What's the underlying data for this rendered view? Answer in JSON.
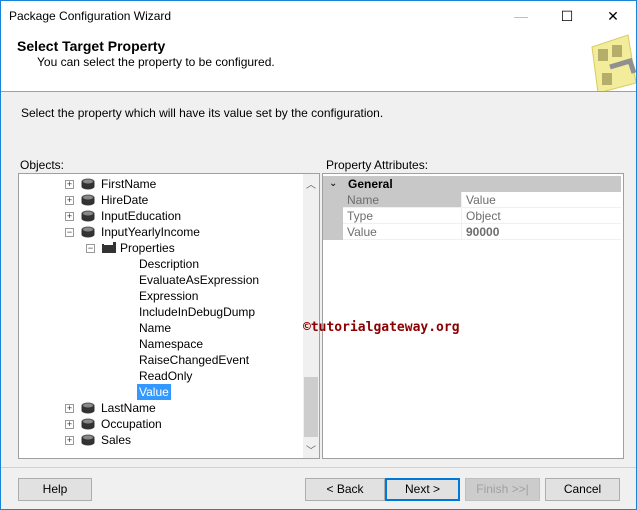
{
  "window": {
    "title": "Package Configuration Wizard",
    "minimize": "—",
    "maximize": "☐",
    "close": "✕"
  },
  "header": {
    "title": "Select Target Property",
    "subtitle": "You can select the property to be configured."
  },
  "instruction": "Select the property which will have its value set by the configuration.",
  "objects": {
    "label": "Objects:",
    "tree": [
      {
        "label": "FirstName",
        "level": 0,
        "expand": "+"
      },
      {
        "label": "HireDate",
        "level": 0,
        "expand": "+"
      },
      {
        "label": "InputEducation",
        "level": 0,
        "expand": "+"
      },
      {
        "label": "InputYearlyIncome",
        "level": 0,
        "expand": "−"
      },
      {
        "label": "Properties",
        "level": 1,
        "expand": "−"
      },
      {
        "label": "Description",
        "level": 2
      },
      {
        "label": "EvaluateAsExpression",
        "level": 2
      },
      {
        "label": "Expression",
        "level": 2
      },
      {
        "label": "IncludeInDebugDump",
        "level": 2
      },
      {
        "label": "Name",
        "level": 2
      },
      {
        "label": "Namespace",
        "level": 2
      },
      {
        "label": "RaiseChangedEvent",
        "level": 2
      },
      {
        "label": "ReadOnly",
        "level": 2
      },
      {
        "label": "Value",
        "level": 2,
        "selected": true
      },
      {
        "label": "LastName",
        "level": 0,
        "expand": "+"
      },
      {
        "label": "Occupation",
        "level": 0,
        "expand": "+"
      },
      {
        "label": "Sales",
        "level": 0,
        "expand": "+"
      }
    ]
  },
  "attributes": {
    "label": "Property Attributes:",
    "group": "General",
    "header": [
      "Name",
      "Value"
    ],
    "rows": [
      [
        "Type",
        "Object"
      ],
      [
        "Value",
        "90000"
      ]
    ]
  },
  "watermark": "©tutorialgateway.org",
  "buttons": {
    "help": "Help",
    "back": "< Back",
    "next": "Next >",
    "finish": "Finish >>|",
    "cancel": "Cancel"
  }
}
